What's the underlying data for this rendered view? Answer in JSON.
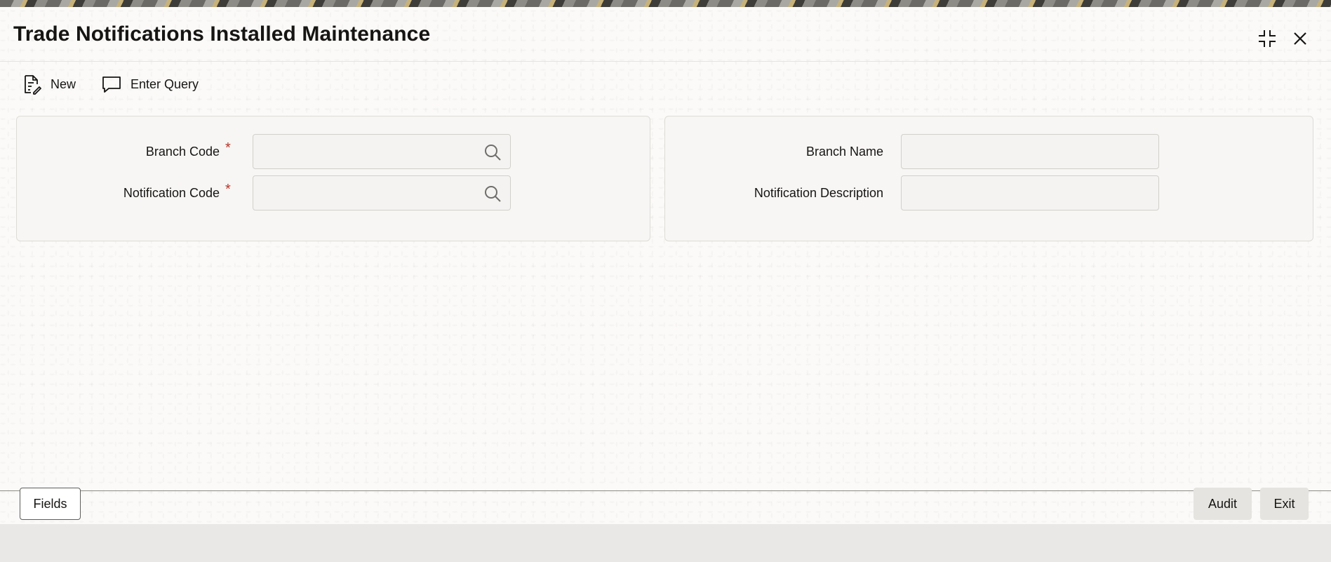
{
  "window": {
    "title": "Trade Notifications Installed Maintenance",
    "controls": {
      "restore_icon": "collapse-icon",
      "close_icon": "close-icon"
    }
  },
  "toolbar": {
    "new_label": "New",
    "new_icon": "new-document-icon",
    "enter_query_label": "Enter Query",
    "enter_query_icon": "speech-bubble-icon"
  },
  "form": {
    "left_panel": {
      "branch_code": {
        "label": "Branch Code",
        "required_mark": "*",
        "value": "",
        "lookup_icon": "search-icon"
      },
      "notification_code": {
        "label": "Notification Code",
        "required_mark": "*",
        "value": "",
        "lookup_icon": "search-icon"
      }
    },
    "right_panel": {
      "branch_name": {
        "label": "Branch Name",
        "value": ""
      },
      "notification_description": {
        "label": "Notification Description",
        "value": ""
      }
    }
  },
  "footer": {
    "fields_label": "Fields",
    "audit_label": "Audit",
    "exit_label": "Exit"
  },
  "colors": {
    "required_mark": "#b5362b",
    "text": "#161513",
    "panel_background": "#f7f6f4"
  }
}
